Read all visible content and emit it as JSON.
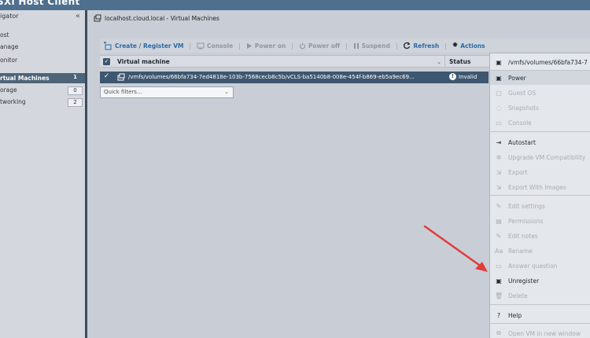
{
  "window": {
    "title": "SXi Host Client"
  },
  "navigator": {
    "header": "igator",
    "collapse_glyph": "«",
    "items": [
      {
        "label": "ost"
      },
      {
        "label": "anage"
      },
      {
        "label": "onitor"
      },
      {
        "label": "rtual Machines",
        "count": "1",
        "selected": true
      },
      {
        "label": "orage",
        "count": "0"
      },
      {
        "label": "tworking",
        "count": "2"
      }
    ]
  },
  "breadcrumb": {
    "text": "localhost.cloud.local - Virtual Machines"
  },
  "toolbar": {
    "create": "Create / Register VM",
    "console": "Console",
    "power_on": "Power on",
    "power_off": "Power off",
    "suspend": "Suspend",
    "refresh": "Refresh",
    "actions": "Actions"
  },
  "grid": {
    "columns": {
      "vm": "Virtual machine",
      "status": "Status"
    },
    "rows": [
      {
        "path": "/vmfs/volumes/66bfa734-7ed4818e-103b-7568cecb8c5b/vCLS-ba5140b8-008e-454f-b869-eb5a9ec69...",
        "status": "Invalid"
      }
    ]
  },
  "quick_filters": {
    "placeholder": "Quick filters..."
  },
  "actions_menu": {
    "items": [
      {
        "label": "/vmfs/volumes/66bfa734-7",
        "icon": "vm-icon",
        "enabled": true
      },
      {
        "label": "Power",
        "icon": "power-icon",
        "enabled": true
      },
      {
        "label": "Guest OS",
        "icon": "guest-os-icon",
        "enabled": false
      },
      {
        "label": "Snapshots",
        "icon": "snapshot-icon",
        "enabled": false
      },
      {
        "label": "Console",
        "icon": "console-icon",
        "enabled": false
      },
      {
        "label": "Autostart",
        "icon": "autostart-icon",
        "enabled": true
      },
      {
        "label": "Upgrade VM Compatibility",
        "icon": "upgrade-icon",
        "enabled": false
      },
      {
        "label": "Export",
        "icon": "export-icon",
        "enabled": false
      },
      {
        "label": "Export With Images",
        "icon": "export-images-icon",
        "enabled": false
      },
      {
        "label": "Edit settings",
        "icon": "edit-settings-icon",
        "enabled": false
      },
      {
        "label": "Permissions",
        "icon": "permissions-icon",
        "enabled": false
      },
      {
        "label": "Edit notes",
        "icon": "edit-notes-icon",
        "enabled": false
      },
      {
        "label": "Rename",
        "icon": "rename-icon",
        "enabled": false
      },
      {
        "label": "Answer question",
        "icon": "answer-question-icon",
        "enabled": false
      },
      {
        "label": "Unregister",
        "icon": "unregister-icon",
        "enabled": true
      },
      {
        "label": "Delete",
        "icon": "delete-icon",
        "enabled": false
      },
      {
        "label": "Help",
        "icon": "help-icon",
        "enabled": true
      },
      {
        "label": "Open VM in new window",
        "icon": "open-window-icon",
        "enabled": false
      }
    ]
  },
  "colors": {
    "accent": "#2c6aa6",
    "selection": "#3e5770",
    "annotation_arrow": "#e23b3b"
  }
}
